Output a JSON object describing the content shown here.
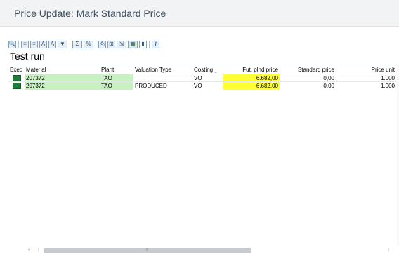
{
  "window": {
    "title": "Price Update: Mark Standard Price"
  },
  "toolbar": {
    "buttons": [
      {
        "icon": "details-icon",
        "glyph": "🔍"
      },
      {
        "icon": "sort-ascending-icon",
        "glyph": "≡"
      },
      {
        "icon": "sort-descending-icon",
        "glyph": "≡"
      },
      {
        "icon": "find-icon",
        "glyph": "A"
      },
      {
        "icon": "find-next-icon",
        "glyph": "A"
      },
      {
        "icon": "filter-icon",
        "glyph": "▼"
      },
      {
        "icon": "total-icon",
        "glyph": "Σ"
      },
      {
        "icon": "subtotal-icon",
        "glyph": "%"
      },
      {
        "icon": "print-icon",
        "glyph": "⎙"
      },
      {
        "icon": "print-preview-icon",
        "glyph": "⊞"
      },
      {
        "icon": "export-icon",
        "glyph": "⇲"
      },
      {
        "icon": "layout-icon",
        "glyph": "▦"
      },
      {
        "icon": "chart-icon",
        "glyph": "▮"
      },
      {
        "icon": "info-icon",
        "glyph": "i"
      }
    ]
  },
  "run": {
    "title": "Test run"
  },
  "table": {
    "columns": {
      "exec": "Exec",
      "material": "Material",
      "plant": "Plant",
      "valuation_type": "Valuation Type",
      "costing": "Costing",
      "fut_plnd_price": "Fut. plnd price",
      "standard_price": "Standard price",
      "price_unit": "Price unit"
    },
    "rows": [
      {
        "material": "207372",
        "plant": "TAO",
        "valuation_type": "",
        "costing": "VO",
        "fut_plnd_price": "6.682,00",
        "standard_price": "0,00",
        "price_unit": "1.000"
      },
      {
        "material": "207372",
        "plant": "TAO",
        "valuation_type": "PRODUCED",
        "costing": "VO",
        "fut_plnd_price": "6.682,00",
        "standard_price": "0,00",
        "price_unit": "1.000"
      }
    ]
  },
  "colors": {
    "exec_indicator": "#1f7a3a",
    "material_highlight": "#c8f0c0",
    "price_highlight": "#ffff33",
    "title_text": "#3c4f63"
  }
}
